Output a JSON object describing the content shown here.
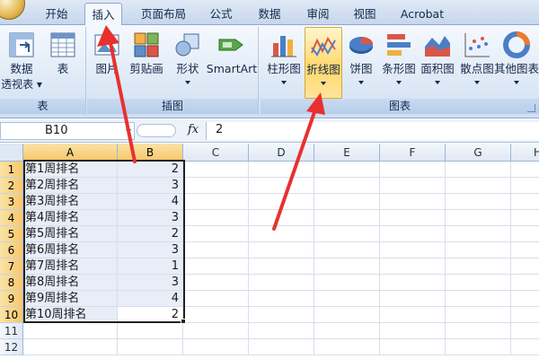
{
  "ribbon": {
    "tabs": [
      {
        "label": "开始"
      },
      {
        "label": "插入"
      },
      {
        "label": "页面布局"
      },
      {
        "label": "公式"
      },
      {
        "label": "数据"
      },
      {
        "label": "审阅"
      },
      {
        "label": "视图"
      },
      {
        "label": "Acrobat"
      }
    ],
    "active_tab": "插入",
    "groups": {
      "table": {
        "label": "表",
        "pivot": {
          "label": "数据",
          "label2": "透视表",
          "icon": "pivot-table-icon"
        },
        "table": {
          "label": "表",
          "icon": "table-icon"
        }
      },
      "illustrations": {
        "label": "插图",
        "picture": {
          "label": "图片",
          "icon": "picture-icon"
        },
        "clipart": {
          "label": "剪贴画",
          "icon": "clipart-icon"
        },
        "shapes": {
          "label": "形状",
          "icon": "shapes-icon"
        },
        "smartart": {
          "label": "SmartArt",
          "icon": "smartart-icon"
        }
      },
      "charts": {
        "label": "图表",
        "column": {
          "label": "柱形图",
          "icon": "column-chart-icon"
        },
        "line": {
          "label": "折线图",
          "icon": "line-chart-icon"
        },
        "pie": {
          "label": "饼图",
          "icon": "pie-chart-icon"
        },
        "bar": {
          "label": "条形图",
          "icon": "bar-chart-icon"
        },
        "area": {
          "label": "面积图",
          "icon": "area-chart-icon"
        },
        "scatter": {
          "label": "散点图",
          "icon": "scatter-chart-icon"
        },
        "other": {
          "label": "其他图表",
          "icon": "other-charts-icon"
        }
      }
    }
  },
  "formula_bar": {
    "name_box": "B10",
    "fx_label": "fx",
    "formula": "2"
  },
  "grid": {
    "columns": [
      "A",
      "B",
      "C",
      "D",
      "E",
      "F",
      "G",
      "H"
    ],
    "rows": [
      "1",
      "2",
      "3",
      "4",
      "5",
      "6",
      "7",
      "8",
      "9",
      "10",
      "11",
      "12"
    ],
    "data": [
      [
        "第1周排名",
        "2"
      ],
      [
        "第2周排名",
        "3"
      ],
      [
        "第3周排名",
        "4"
      ],
      [
        "第4周排名",
        "3"
      ],
      [
        "第5周排名",
        "2"
      ],
      [
        "第6周排名",
        "3"
      ],
      [
        "第7周排名",
        "1"
      ],
      [
        "第8周排名",
        "3"
      ],
      [
        "第9周排名",
        "4"
      ],
      [
        "第10周排名",
        "2"
      ]
    ]
  },
  "colors": {
    "annotation_arrow": "#e8312f",
    "selected_header": "#f7c76a",
    "highlight_button": "#ffd86b"
  }
}
